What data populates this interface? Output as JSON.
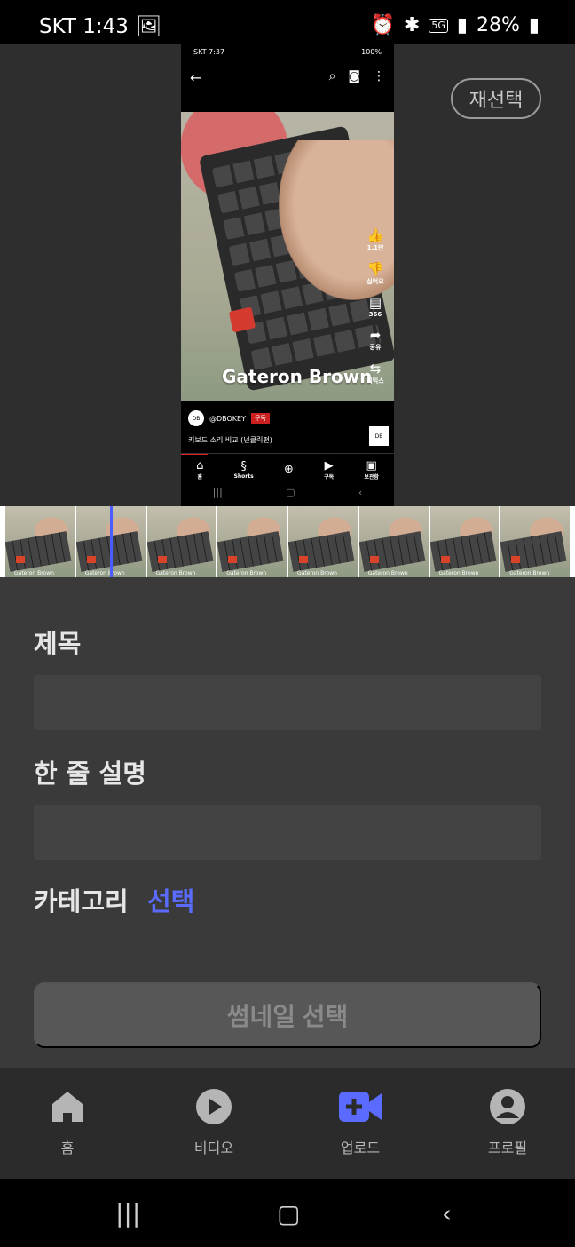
{
  "status_bar": {
    "carrier_time": "SKT 1:43",
    "network": "5G",
    "battery": "28%"
  },
  "reselect_button": "재선택",
  "preview": {
    "status": {
      "time": "SKT 7:37",
      "battery": "100%"
    },
    "caption": "Gateron Brown",
    "side_actions": [
      {
        "icon": "like-icon",
        "label": "1.1만"
      },
      {
        "icon": "dislike-icon",
        "label": "싫어요"
      },
      {
        "icon": "comment-icon",
        "label": "366"
      },
      {
        "icon": "share-icon",
        "label": "공유"
      },
      {
        "icon": "remix-icon",
        "label": "리믹스"
      }
    ],
    "channel": {
      "avatar": "DB",
      "name": "@DBOKEY",
      "subscribe": "구독",
      "title": "키보드 소리 비교 (넌클릭편)",
      "thumb": "DB"
    },
    "nav": [
      "홈",
      "Shorts",
      "",
      "구독",
      "보관함"
    ]
  },
  "filmstrip": {
    "frame_count": 8,
    "frame_label": "Gateron Brown"
  },
  "form": {
    "title_label": "제목",
    "title_value": "",
    "desc_label": "한 줄 설명",
    "desc_value": "",
    "category_label": "카테고리",
    "category_select": "선택",
    "thumbnail_button": "썸네일 선택"
  },
  "bottom_nav": {
    "items": [
      {
        "label": "홈",
        "icon": "home-icon"
      },
      {
        "label": "비디오",
        "icon": "play-icon"
      },
      {
        "label": "업로드",
        "icon": "video-upload-icon"
      },
      {
        "label": "프로필",
        "icon": "profile-icon"
      }
    ],
    "active_index": 2,
    "accent": "#5b6bff",
    "inactive": "#b5b5b5"
  }
}
